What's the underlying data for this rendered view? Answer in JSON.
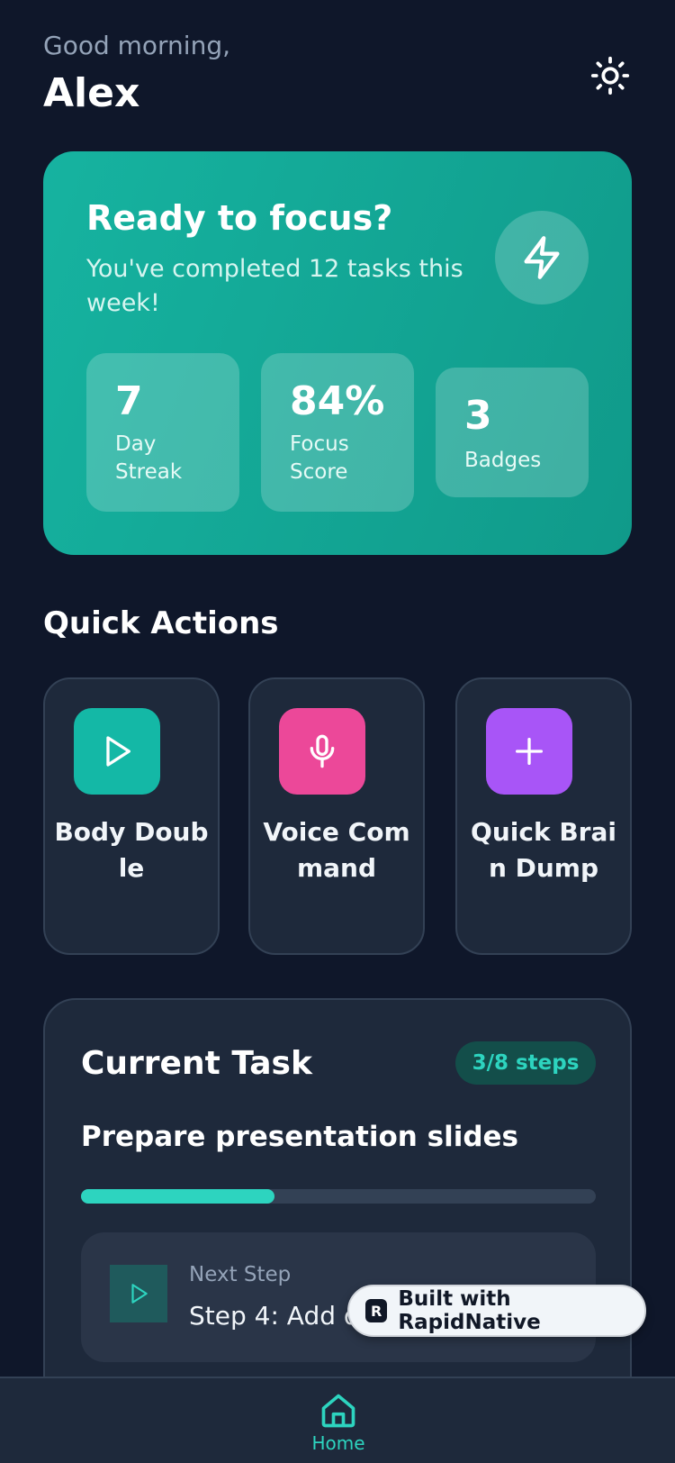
{
  "header": {
    "greeting": "Good morning,",
    "username": "Alex",
    "theme_icon": "sun-icon"
  },
  "hero": {
    "title": "Ready to focus?",
    "subtitle": "You've completed 12 tasks this week!",
    "icon": "lightning-bolt-icon",
    "stats": [
      {
        "value": "7",
        "label": "Day Streak"
      },
      {
        "value": "84%",
        "label": "Focus Score"
      },
      {
        "value": "3",
        "label": "Badges"
      }
    ]
  },
  "quick_actions": {
    "title": "Quick Actions",
    "items": [
      {
        "label": "Body Double",
        "icon": "play-icon",
        "color": "#14b8a6"
      },
      {
        "label": "Voice Command",
        "icon": "microphone-icon",
        "color": "#ec4899"
      },
      {
        "label": "Quick Brain Dump",
        "icon": "plus-icon",
        "color": "#a855f7"
      }
    ]
  },
  "current_task": {
    "heading": "Current Task",
    "steps_badge": "3/8 steps",
    "progress": 0.375,
    "name": "Prepare presentation slides",
    "next_step_label": "Next Step",
    "next_step_text": "Step 4: Add d"
  },
  "built_badge": {
    "logo": "R",
    "text": "Built with RapidNative"
  },
  "bottom_nav": {
    "items": [
      {
        "label": "Home",
        "icon": "home-icon",
        "active": true
      }
    ]
  },
  "colors": {
    "background": "#0f172a",
    "card": "#1e293b",
    "accent": "#2dd4bf",
    "hero_gradient_start": "#16b3a0",
    "hero_gradient_end": "#109a8a"
  }
}
